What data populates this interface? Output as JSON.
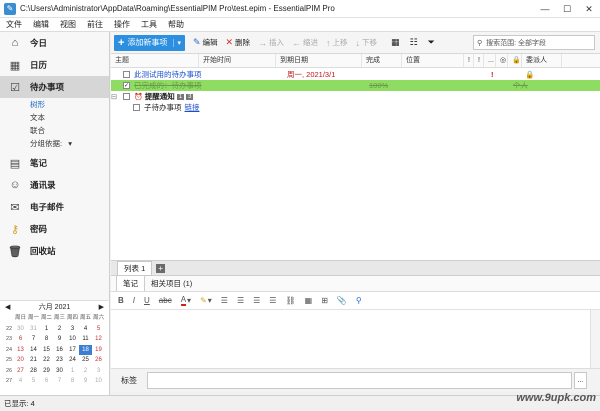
{
  "window": {
    "title": "C:\\Users\\Administrator\\AppData\\Roaming\\EssentialPIM Pro\\test.epim - EssentialPIM Pro",
    "min": "—",
    "max": "☐",
    "close": "✕"
  },
  "menu": [
    "文件",
    "编辑",
    "视图",
    "前往",
    "操作",
    "工具",
    "帮助"
  ],
  "sidebar": {
    "items": [
      {
        "label": "今日",
        "icon": "home-icon"
      },
      {
        "label": "日历",
        "icon": "calendar-icon"
      },
      {
        "label": "待办事项",
        "icon": "task-icon"
      }
    ],
    "sub_items": [
      "树形",
      "文本",
      "联合"
    ],
    "group_by": "分组依据:",
    "group_by_arrow": "▾",
    "items2": [
      {
        "label": "笔记",
        "icon": "note-icon"
      },
      {
        "label": "通讯录",
        "icon": "contacts-icon"
      },
      {
        "label": "电子邮件",
        "icon": "mail-icon"
      },
      {
        "label": "密码",
        "icon": "key-icon"
      },
      {
        "label": "回收站",
        "icon": "trash-icon"
      }
    ]
  },
  "calendar": {
    "prev": "◀",
    "month_label": "六月   2021",
    "next": "▶",
    "dow": [
      "周日",
      "周一",
      "周二",
      "周三",
      "周四",
      "周五",
      "周六"
    ],
    "weeks": [
      {
        "n": "22",
        "days": [
          "30",
          "31",
          "1",
          "2",
          "3",
          "4",
          "5"
        ]
      },
      {
        "n": "23",
        "days": [
          "6",
          "7",
          "8",
          "9",
          "10",
          "11",
          "12"
        ]
      },
      {
        "n": "24",
        "days": [
          "13",
          "14",
          "15",
          "16",
          "17",
          "18",
          "19"
        ]
      },
      {
        "n": "25",
        "days": [
          "20",
          "21",
          "22",
          "23",
          "24",
          "25",
          "26"
        ]
      },
      {
        "n": "26",
        "days": [
          "27",
          "28",
          "29",
          "30",
          "1",
          "2",
          "3"
        ]
      },
      {
        "n": "27",
        "days": [
          "4",
          "5",
          "6",
          "7",
          "8",
          "9",
          "10"
        ]
      }
    ],
    "today": "18"
  },
  "toolbar": {
    "add_label": "添加新事项",
    "edit": "编辑",
    "delete": "删除",
    "insert": "插入",
    "indent": "缩进",
    "up": "上移",
    "down": "下移",
    "search_placeholder": "搜索范围: 全部字段"
  },
  "table": {
    "columns": [
      "主题",
      "开始时间",
      "到期日期",
      "完成",
      "位置",
      "!",
      "!",
      "...",
      "◎",
      "🔒",
      "委派人"
    ],
    "rows": [
      {
        "subject": "此测试用的待办事项",
        "due": "周一, 2021/3/1",
        "complete": ""
      },
      {
        "subject": "已完成的：待办事项",
        "due": "",
        "complete": "100%",
        "delegate": "个人"
      },
      {
        "subject": "提醒通知",
        "due": "",
        "complete": "",
        "tag1": "1",
        "tag2": "3"
      },
      {
        "subject": "子待办事项",
        "due": "",
        "complete": "",
        "tag": "链接"
      }
    ]
  },
  "list_tabs": {
    "tab1": "列表 1",
    "add": "+"
  },
  "note_tabs": [
    "笔记",
    "相关项目 (1)"
  ],
  "format_bar": [
    "B",
    "I",
    "U",
    "abc",
    "A",
    "▾",
    "✎",
    "▾",
    "☰",
    "☰",
    "☰",
    "☰",
    "⛓",
    "▦",
    "⊞",
    "📎",
    "⚲"
  ],
  "tag_row": {
    "label": "标签",
    "more": "..."
  },
  "status": "已显示: 4",
  "watermark": "www.9upk.com"
}
